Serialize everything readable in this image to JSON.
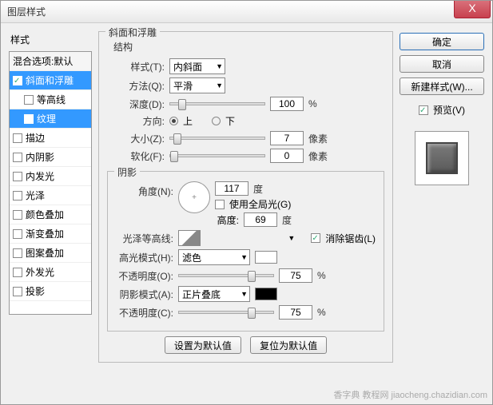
{
  "window": {
    "title": "图层样式"
  },
  "close": "X",
  "left": {
    "heading": "样式",
    "blend": "混合选项:默认",
    "bevel": "斜面和浮雕",
    "contour": "等高线",
    "texture": "纹理",
    "stroke": "描边",
    "innerShadow": "内阴影",
    "innerGlow": "内发光",
    "satin": "光泽",
    "colorOverlay": "颜色叠加",
    "gradientOverlay": "渐变叠加",
    "patternOverlay": "图案叠加",
    "outerGlow": "外发光",
    "dropShadow": "投影"
  },
  "bevel": {
    "group": "斜面和浮雕",
    "structure": "结构",
    "styleLabel": "样式(T):",
    "styleValue": "内斜面",
    "techLabel": "方法(Q):",
    "techValue": "平滑",
    "depthLabel": "深度(D):",
    "depthValue": "100",
    "pct": "%",
    "dirLabel": "方向:",
    "up": "上",
    "down": "下",
    "sizeLabel": "大小(Z):",
    "sizeValue": "7",
    "px": "像素",
    "softLabel": "软化(F):",
    "softValue": "0"
  },
  "shade": {
    "group": "阴影",
    "angleLabel": "角度(N):",
    "angleValue": "117",
    "deg": "度",
    "globalLight": "使用全局光(G)",
    "altLabel": "高度:",
    "altValue": "69",
    "glossLabel": "光泽等高线:",
    "antialias": "消除锯齿(L)",
    "hlModeLabel": "高光模式(H):",
    "hlModeValue": "滤色",
    "hlOpLabel": "不透明度(O):",
    "hlOpValue": "75",
    "shModeLabel": "阴影模式(A):",
    "shModeValue": "正片叠底",
    "shOpLabel": "不透明度(C):",
    "shOpValue": "75"
  },
  "buttons": {
    "makeDefault": "设置为默认值",
    "resetDefault": "复位为默认值"
  },
  "right": {
    "ok": "确定",
    "cancel": "取消",
    "newStyle": "新建样式(W)...",
    "preview": "预览(V)"
  },
  "watermark": "香字典 教程网 jiaocheng.chazidian.com"
}
